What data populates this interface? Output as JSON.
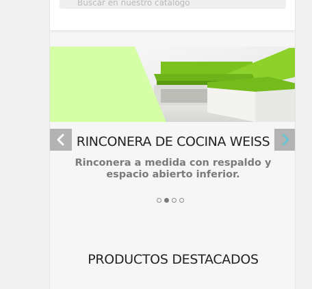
{
  "search": {
    "placeholder": "Buscar en nuestro catálogo"
  },
  "slider": {
    "title": "RINCONERA DE COCINA WEISS",
    "description": "Rinconera a medida con respaldo y espacio abierto inferior.",
    "slide_count": 4,
    "active_index": 1,
    "image_alt": "corner-bench-with-green-cushions"
  },
  "featured": {
    "title": "PRODUCTOS DESTACADOS"
  },
  "colors": {
    "accent_green": "#d6fea6",
    "cushion_green": "#7cc21f",
    "arrow_accent": "#39b3c6"
  }
}
